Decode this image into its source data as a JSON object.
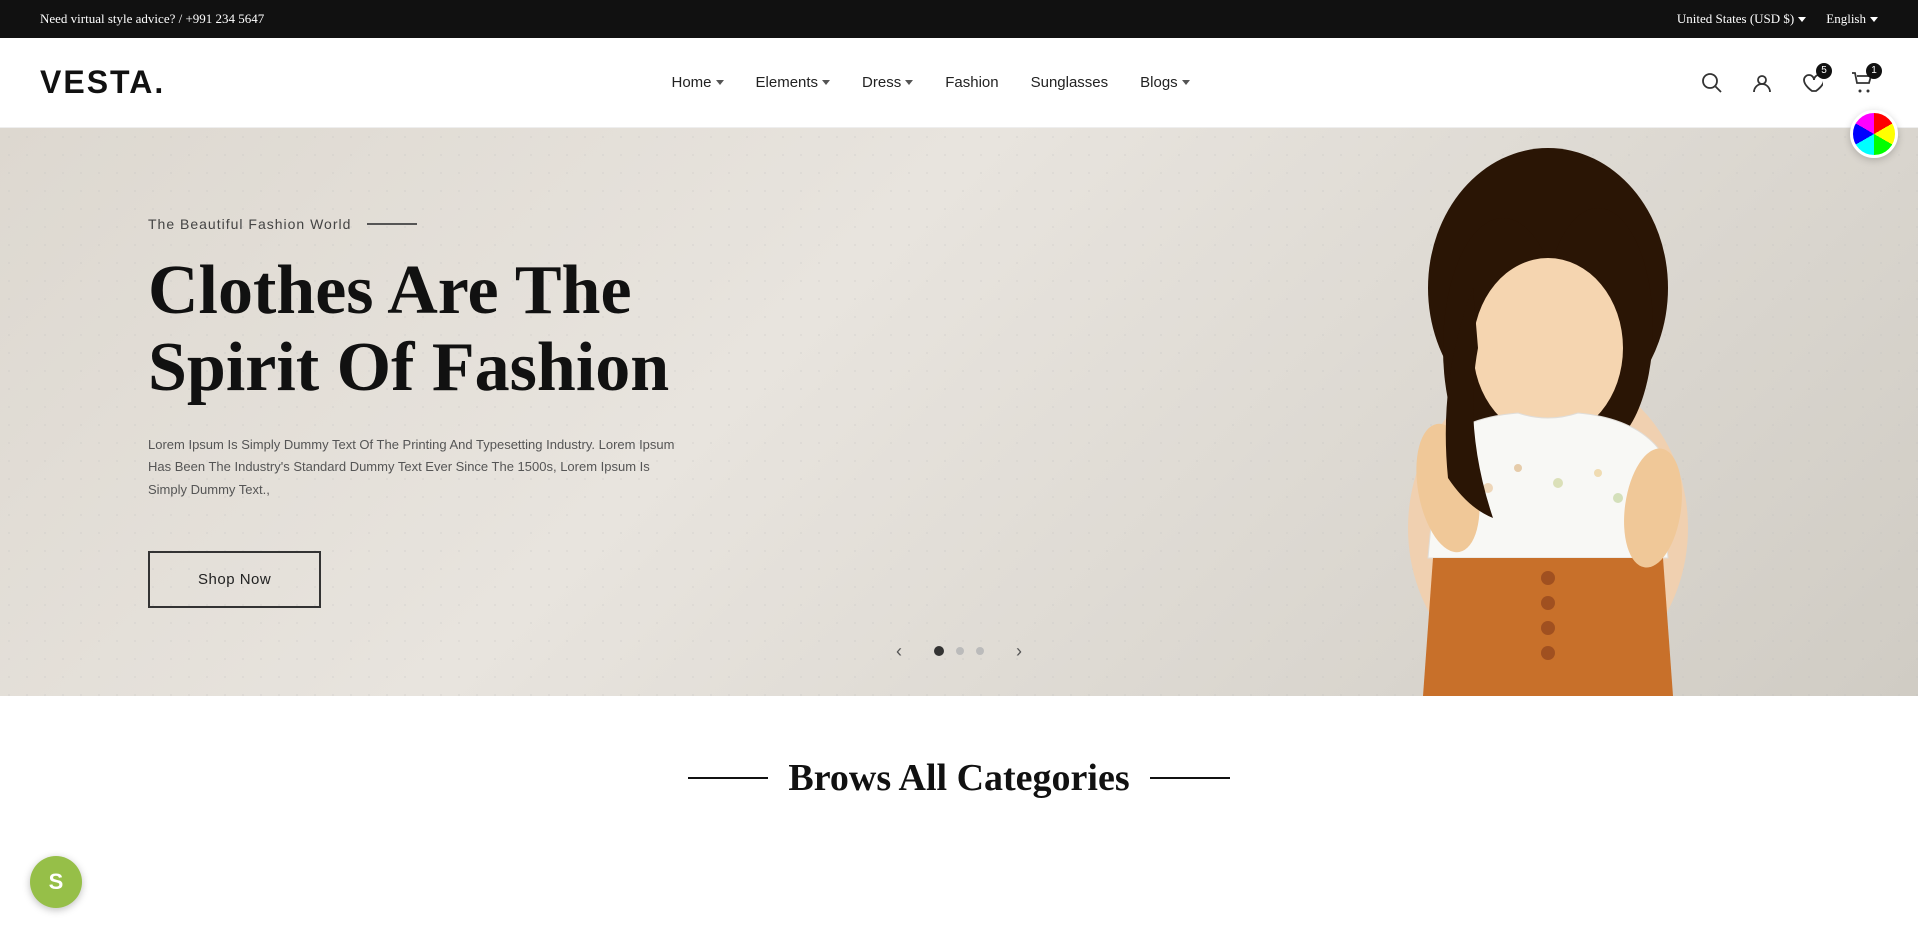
{
  "topBar": {
    "advisory": "Need virtual style advice? / +991 234 5647",
    "region": "United States (USD $)",
    "language": "English"
  },
  "header": {
    "logo": "VESTA.",
    "nav": [
      {
        "id": "home",
        "label": "Home",
        "hasDropdown": true
      },
      {
        "id": "elements",
        "label": "Elements",
        "hasDropdown": true
      },
      {
        "id": "dress",
        "label": "Dress",
        "hasDropdown": true
      },
      {
        "id": "fashion",
        "label": "Fashion",
        "hasDropdown": false
      },
      {
        "id": "sunglasses",
        "label": "Sunglasses",
        "hasDropdown": false
      },
      {
        "id": "blogs",
        "label": "Blogs",
        "hasDropdown": true
      }
    ],
    "wishlistCount": "5",
    "cartCount": "1"
  },
  "hero": {
    "subtitle": "The Beautiful Fashion World",
    "title": "Clothes Are The Spirit Of Fashion",
    "description": "Lorem Ipsum Is Simply Dummy Text Of The Printing And Typesetting Industry. Lorem Ipsum Has Been The Industry's Standard Dummy Text Ever Since The 1500s, Lorem Ipsum Is Simply Dummy Text.,",
    "cta": "Shop Now",
    "slides": [
      "1",
      "2",
      "3"
    ],
    "activeSlide": "1"
  },
  "bottomSection": {
    "title": "Brows All Categories"
  }
}
